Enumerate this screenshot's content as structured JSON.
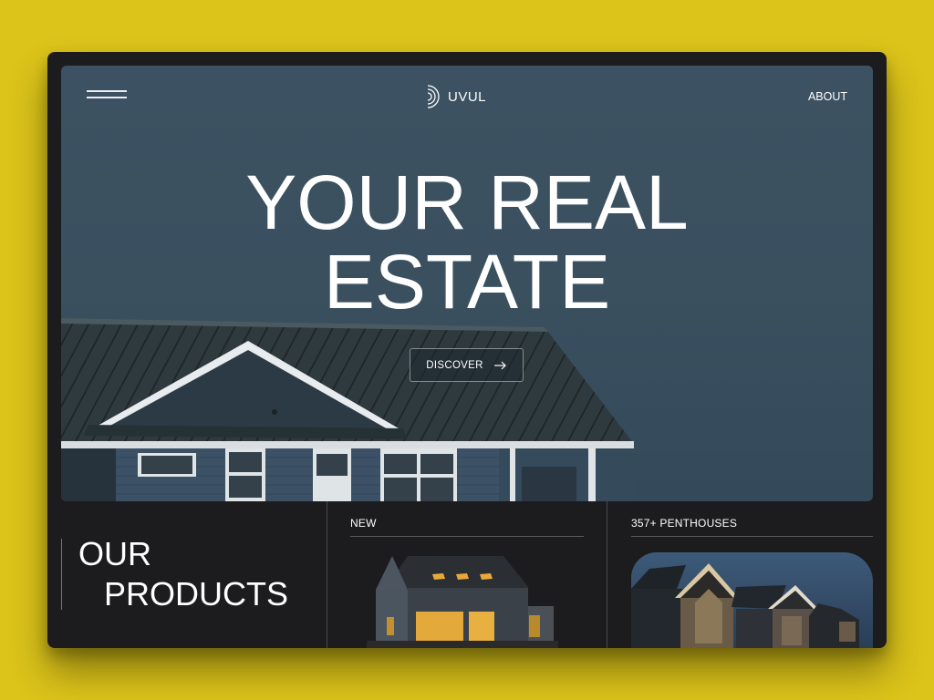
{
  "header": {
    "logo_text": "UVUL",
    "about_label": "ABOUT"
  },
  "hero": {
    "headline_line1": "YOUR REAL",
    "headline_line2": "ESTATE",
    "discover_label": "DISCOVER"
  },
  "products": {
    "title_line1": "OUR",
    "title_line2": "PRODUCTS",
    "cards": [
      {
        "label": "NEW"
      },
      {
        "label": "357+ PENTHOUSES"
      }
    ]
  },
  "icons": [
    "menu-icon",
    "logo-icon",
    "arrow-right-icon"
  ],
  "colors": {
    "background": "#dcc41a",
    "frame": "#1c1c1e",
    "sky": "#3c5262",
    "text": "#ffffff"
  }
}
